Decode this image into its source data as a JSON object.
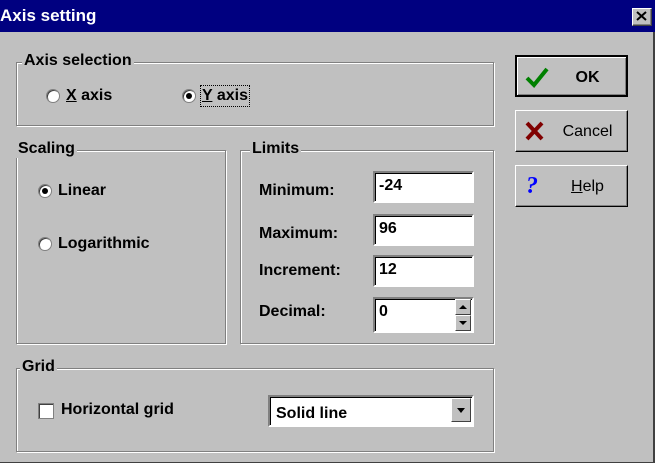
{
  "window": {
    "title": "Axis setting"
  },
  "axis_selection": {
    "label": "Axis selection",
    "options": [
      {
        "label": "X axis",
        "mnemonic": "X",
        "rest": " axis",
        "selected": false
      },
      {
        "label": "Y axis",
        "mnemonic": "Y",
        "rest": " axis",
        "selected": true
      }
    ]
  },
  "scaling": {
    "label": "Scaling",
    "options": [
      {
        "label": "Linear",
        "selected": true
      },
      {
        "label": "Logarithmic",
        "selected": false
      }
    ]
  },
  "limits": {
    "label": "Limits",
    "minimum": {
      "label": "Minimum:",
      "value": "-24"
    },
    "maximum": {
      "label": "Maximum:",
      "value": "96"
    },
    "increment": {
      "label": "Increment:",
      "value": "12"
    },
    "decimal": {
      "label": "Decimal:",
      "value": "0"
    }
  },
  "grid": {
    "label": "Grid",
    "horizontal_grid": {
      "label": "Horizontal grid",
      "checked": false
    },
    "line_style": "Solid line"
  },
  "buttons": {
    "ok": "OK",
    "cancel": "Cancel",
    "help_mnemonic": "H",
    "help_rest": "elp"
  },
  "icons": {
    "ok": "check-icon",
    "cancel": "x-icon",
    "help": "question-icon"
  },
  "colors": {
    "titlebar": "#000080",
    "face": "#c0c0c0",
    "ok_check": "#008000",
    "cancel_x": "#800000",
    "help_q": "#0000ff"
  }
}
